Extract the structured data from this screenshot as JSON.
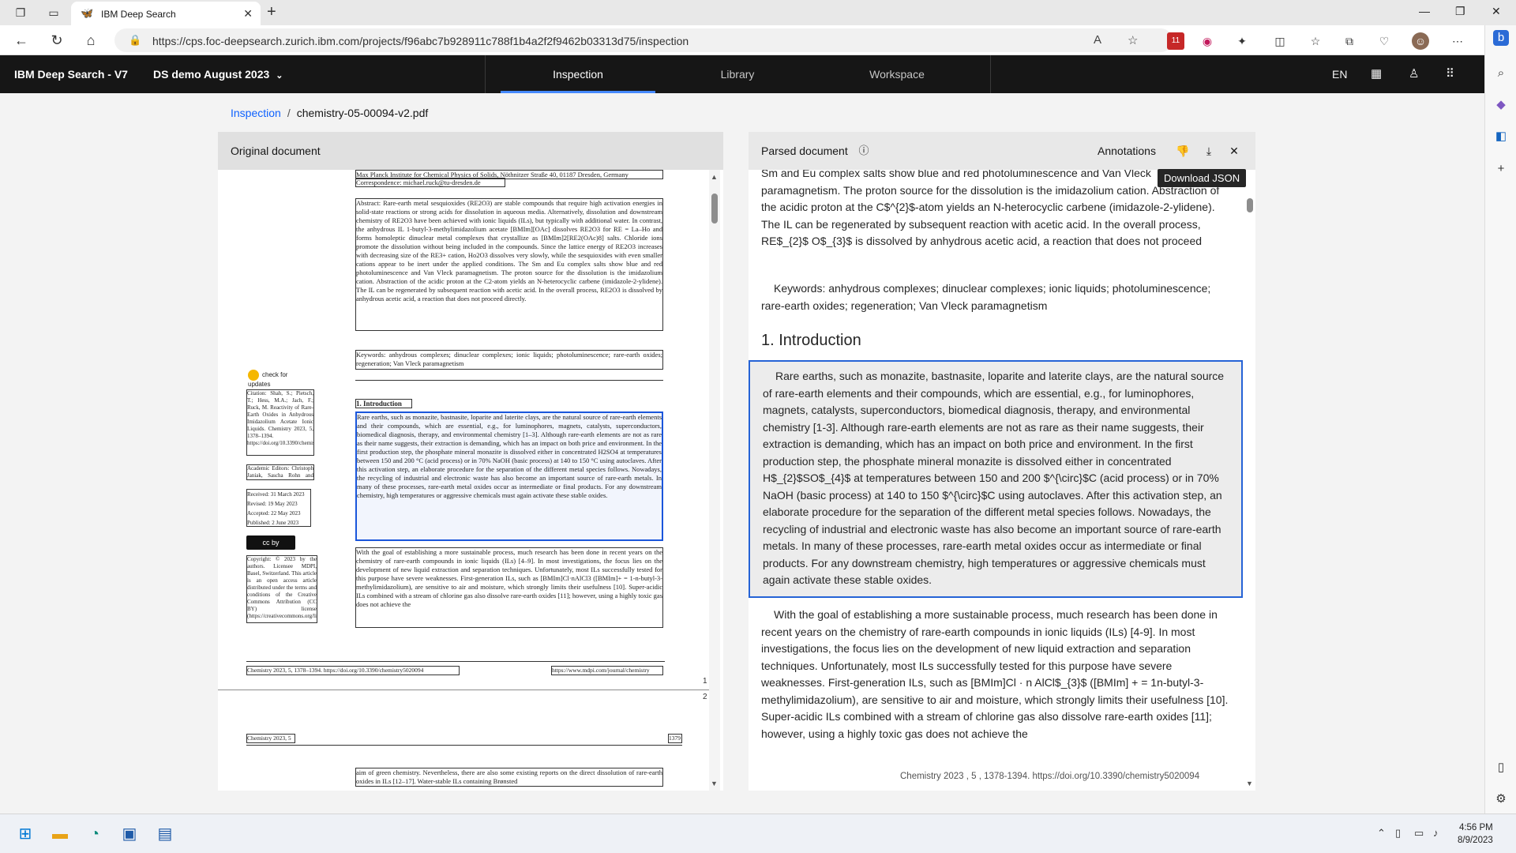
{
  "browser": {
    "tab_title": "IBM Deep Search",
    "url": "https://cps.foc-deepsearch.zurich.ibm.com/projects/f96abc7b928911c788f1b4a2f2f9462b03313d75/inspection",
    "extension_badge": "11"
  },
  "app": {
    "brand": "IBM Deep Search - V7",
    "project": "DS demo August 2023",
    "nav": [
      "Inspection",
      "Library",
      "Workspace"
    ],
    "active_nav": "Inspection",
    "language": "EN"
  },
  "breadcrumb": {
    "root": "Inspection",
    "separator": "/",
    "current": "chemistry-05-00094-v2.pdf"
  },
  "left_panel": {
    "title": "Original document",
    "pdf": {
      "affiliation": "Max Planck Institute for Chemical Physics of Solids, Nöthnitzer Straße 40, 01187 Dresden, Germany",
      "correspondence": "Correspondence: michael.ruck@tu-dresden.de",
      "abstract": "Abstract: Rare-earth metal sesquioxides (RE2O3) are stable compounds that require high activation energies in solid-state reactions or strong acids for dissolution in aqueous media. Alternatively, dissolution and downstream chemistry of RE2O3 have been achieved with ionic liquids (ILs), but typically with additional water. In contrast, the anhydrous IL 1-butyl-3-methylimidazolium acetate [BMIm][OAc] dissolves RE2O3 for RE = La–Ho and forms homoleptic dinuclear metal complexes that crystallize as [BMIm]2[RE2(OAc)8] salts. Chloride ions promote the dissolution without being included in the compounds. Since the lattice energy of RE2O3 increases with decreasing size of the RE3+ cation, Ho2O3 dissolves very slowly, while the sesquioxides with even smaller cations appear to be inert under the applied conditions. The Sm and Eu complex salts show blue and red photoluminescence and Van Vleck paramagnetism. The proton source for the dissolution is the imidazolium cation. Abstraction of the acidic proton at the C2-atom yields an N-heterocyclic carbene (imidazole-2-ylidene). The IL can be regenerated by subsequent reaction with acetic acid. In the overall process, RE2O3 is dissolved by anhydrous acetic acid, a reaction that does not proceed directly.",
      "keywords": "Keywords: anhydrous complexes; dinuclear complexes; ionic liquids; photoluminescence; rare-earth oxides; regeneration; Van Vleck paramagnetism",
      "check_updates": "check for updates",
      "citation": "Citation: Shah, S.; Pietsch, T.; Hess, M.A.; Jach, F.; Ruck, M. Reactivity of Rare-Earth Oxides in Anhydrous Imidazolium Acetate Ionic Liquids. Chemistry 2023, 5, 1378–1394. https://doi.org/10.3390/chemistry5020094",
      "editors": "Academic Editors: Christoph Janiak, Sascha Rohn and Georg Manolikakes",
      "received": "Received: 31 March 2023",
      "revised": "Revised: 19 May 2023",
      "accepted": "Accepted: 22 May 2023",
      "published": "Published: 2 June 2023",
      "cc": "cc by",
      "copyright": "Copyright: © 2023 by the authors. Licensee MDPI, Basel, Switzerland. This article is an open access article distributed under the terms and conditions of the Creative Commons Attribution (CC BY) license (https://creativecommons.org/licenses/by/4.0/).",
      "intro_heading": "1. Introduction",
      "intro_p1": "Rare earths, such as monazite, bastnasite, loparite and laterite clays, are the natural source of rare-earth elements and their compounds, which are essential, e.g., for luminophores, magnets, catalysts, superconductors, biomedical diagnosis, therapy, and environmental chemistry [1–3]. Although rare-earth elements are not as rare as their name suggests, their extraction is demanding, which has an impact on both price and environment. In the first production step, the phosphate mineral monazite is dissolved either in concentrated H2SO4 at temperatures between 150 and 200 °C (acid process) or in 70% NaOH (basic process) at 140 to 150 °C using autoclaves. After this activation step, an elaborate procedure for the separation of the different metal species follows. Nowadays, the recycling of industrial and electronic waste has also become an important source of rare-earth metals. In many of these processes, rare-earth metal oxides occur as intermediate or final products. For any downstream chemistry, high temperatures or aggressive chemicals must again activate these stable oxides.",
      "intro_p2": "With the goal of establishing a more sustainable process, much research has been done in recent years on the chemistry of rare-earth compounds in ionic liquids (ILs) [4–9]. In most investigations, the focus lies on the development of new liquid extraction and separation techniques. Unfortunately, most ILs successfully tested for this purpose have severe weaknesses. First-generation ILs, such as [BMIm]Cl·nAlCl3 ([BMIm]+ = 1-n-butyl-3-methylimidazolium), are sensitive to air and moisture, which strongly limits their usefulness [10]. Super-acidic ILs combined with a stream of chlorine gas also dissolve rare-earth oxides [11]; however, using a highly toxic gas does not achieve the",
      "footer_left": "Chemistry 2023, 5, 1378–1394. https://doi.org/10.3390/chemistry5020094",
      "footer_right": "https://www.mdpi.com/journal/chemistry",
      "page_1": "1",
      "page_2": "2",
      "p2_header_left": "Chemistry 2023, 5",
      "p2_header_right": "1379",
      "p2_text": "aim of green chemistry. Nevertheless, there are also some existing reports on the direct dissolution of rare-earth oxides in ILs [12–17]. Water-stable ILs containing Brønsted"
    }
  },
  "right_panel": {
    "title": "Parsed document",
    "annotations_label": "Annotations",
    "tooltip": "Download JSON",
    "abstract_tail": "Sm and Eu complex salts show blue and red photoluminescence and Van Vleck paramagnetism. The proton source for the dissolution is the imidazolium cation. Abstraction of the acidic proton at the C$^{2}$-atom yields an N-heterocyclic carbene (imidazole-2-ylidene). The IL can be regenerated by subsequent reaction with acetic acid. In the overall process, RE$_{2}$ O$_{3}$ is dissolved by anhydrous acetic acid, a reaction that does not proceed directly.",
    "keywords": "Keywords: anhydrous complexes; dinuclear complexes; ionic liquids; photoluminescence; rare-earth oxides; regeneration; Van Vleck paramagnetism",
    "section_heading": "1. Introduction",
    "selected_paragraph": "Rare earths, such as monazite, bastnasite, loparite and laterite clays, are the natural source of rare-earth elements and their compounds, which are essential, e.g., for luminophores, magnets, catalysts, superconductors, biomedical diagnosis, therapy, and environmental chemistry [1-3]. Although rare-earth elements are not as rare as their name suggests, their extraction is demanding, which has an impact on both price and environment. In the first production step, the phosphate mineral monazite is dissolved either in concentrated H$_{2}$SO$_{4}$ at temperatures between 150 and 200 $^{\\circ}$C (acid process) or in 70% NaOH (basic process) at 140 to 150 $^{\\circ}$C using autoclaves. After this activation step, an elaborate procedure for the separation of the different metal species follows. Nowadays, the recycling of industrial and electronic waste has also become an important source of rare-earth metals. In many of these processes, rare-earth metal oxides occur as intermediate or final products. For any downstream chemistry, high temperatures or aggressive chemicals must again activate these stable oxides.",
    "next_paragraph": "With the goal of establishing a more sustainable process, much research has been done in recent years on the chemistry of rare-earth compounds in ionic liquids (ILs) [4-9]. In most investigations, the focus lies on the development of new liquid extraction and separation techniques. Unfortunately, most ILs successfully tested for this purpose have severe weaknesses. First-generation ILs, such as [BMIm]Cl · n AlCl$_{3}$ ([BMIm] + = 1n-butyl-3-methylimidazolium), are sensitive to air and moisture, which strongly limits their usefulness [10]. Super-acidic ILs combined with a stream of chlorine gas also dissolve rare-earth oxides [11]; however, using a highly toxic gas does not achieve the",
    "footer": "Chemistry 2023 , 5 , 1378-1394. https://doi.org/10.3390/chemistry5020094"
  },
  "taskbar": {
    "time": "4:56 PM",
    "date": "8/9/2023"
  },
  "colors": {
    "accent": "#0f62fe",
    "header_bg": "#161616",
    "selection_border": "#2563d6"
  }
}
